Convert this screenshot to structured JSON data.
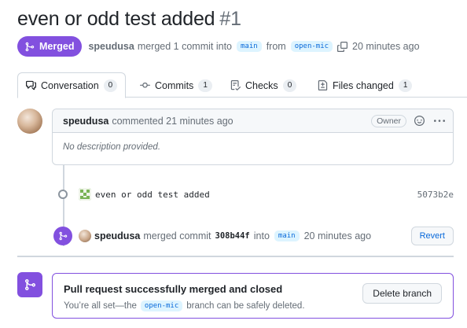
{
  "pr": {
    "title": "even or odd test added",
    "number": "#1",
    "state_label": "Merged",
    "author": "speudusa",
    "merge_text": "merged 1 commit into",
    "base_branch": "main",
    "from_text": "from",
    "head_branch": "open-mic",
    "time_ago": "20 minutes ago"
  },
  "tabs": [
    {
      "label": "Conversation",
      "count": "0"
    },
    {
      "label": "Commits",
      "count": "1"
    },
    {
      "label": "Checks",
      "count": "0"
    },
    {
      "label": "Files changed",
      "count": "1"
    }
  ],
  "comment": {
    "author": "speudusa",
    "action": "commented 21 minutes ago",
    "role_badge": "Owner",
    "body": "No description provided."
  },
  "commit": {
    "message": "even or odd test added",
    "sha": "5073b2e"
  },
  "merge_event": {
    "author": "speudusa",
    "text": "merged commit",
    "sha": "308b44f",
    "into_text": "into",
    "branch": "main",
    "time": "20 minutes ago",
    "revert_label": "Revert"
  },
  "merge_status": {
    "title": "Pull request successfully merged and closed",
    "desc_prefix": "You’re all set—the",
    "branch": "open-mic",
    "desc_suffix": "branch can be safely deleted.",
    "delete_label": "Delete branch"
  },
  "colors": {
    "merged_purple": "#8250df",
    "link_blue": "#0969da",
    "muted_text": "#656d76",
    "border": "#d0d7de"
  }
}
